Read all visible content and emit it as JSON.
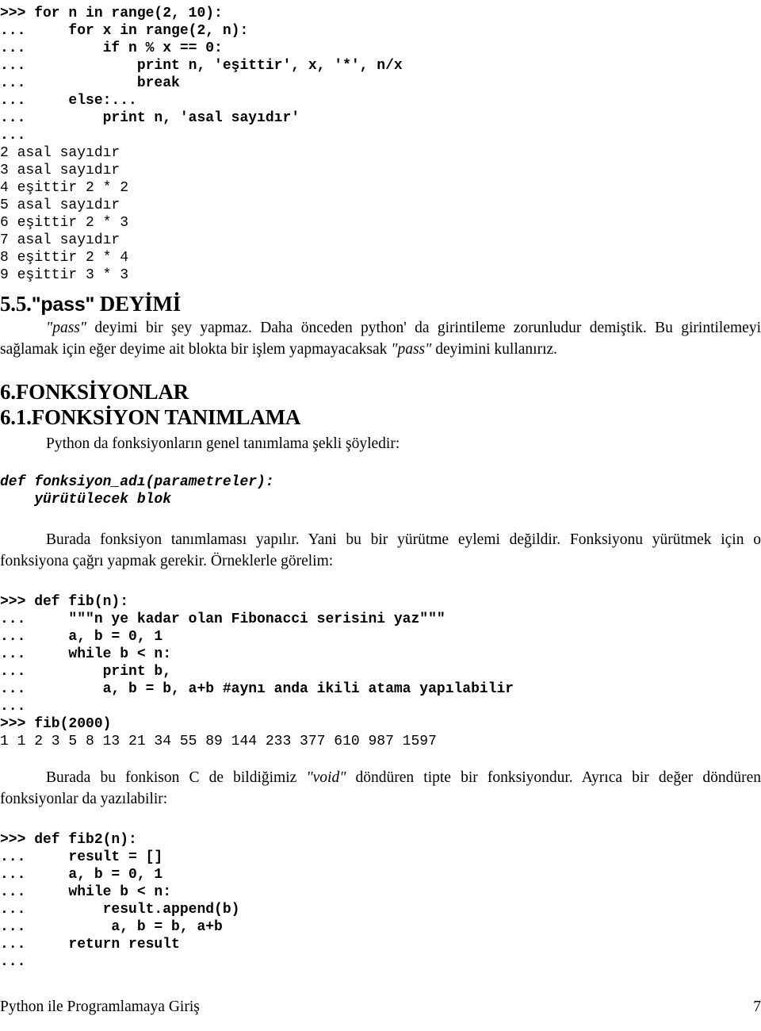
{
  "document": {
    "footer": {
      "title": "Python ile Programlamaya Giriş",
      "page_number": "7"
    }
  },
  "console_block_primes": {
    "name": "prime-loop-console",
    "lines": [
      {
        "text": ">>> for n in range(2, 10):",
        "style": "bold"
      },
      {
        "text": "...     for x in range(2, n):",
        "style": "bold"
      },
      {
        "text": "...         if n % x == 0:",
        "style": "bold"
      },
      {
        "text": "...             print n, 'eşittir', x, '*', n/x",
        "style": "bold"
      },
      {
        "text": "...             break",
        "style": "bold"
      },
      {
        "text": "...     else:...",
        "style": "bold"
      },
      {
        "text": "...         print n, 'asal sayıdır'",
        "style": "bold"
      },
      {
        "text": "...",
        "style": "bold"
      },
      {
        "text": "2 asal sayıdır",
        "style": "plain"
      },
      {
        "text": "3 asal sayıdır",
        "style": "plain"
      },
      {
        "text": "4 eşittir 2 * 2",
        "style": "plain"
      },
      {
        "text": "5 asal sayıdır",
        "style": "plain"
      },
      {
        "text": "6 eşittir 2 * 3",
        "style": "plain"
      },
      {
        "text": "7 asal sayıdır",
        "style": "plain"
      },
      {
        "text": "8 eşittir 2 * 4",
        "style": "plain"
      },
      {
        "text": "9 eşittir 3 * 3",
        "style": "plain"
      }
    ]
  },
  "section_pass": {
    "heading_number": "5.5.",
    "heading_quoted": "\"pass\"",
    "heading_rest": " DEYİMİ",
    "paragraph_part1": "\"pass\"",
    "paragraph_part2": " deyimi bir şey yapmaz. Daha önceden python' da girintileme zorunludur demiştik. Bu girintilemeyi sağlamak için eğer deyime ait blokta bir işlem yapmayacaksak ",
    "paragraph_part3": "\"pass\"",
    "paragraph_part4": " deyimini kullanırız."
  },
  "section_functions": {
    "heading_main": "6.FONKSİYONLAR",
    "heading_sub": "6.1.FONKSİYON TANIMLAMA",
    "intro": "Python da fonksiyonların genel tanımlama şekli şöyledir:"
  },
  "syntax_block": {
    "name": "function-definition-syntax",
    "lines": [
      {
        "text": "def fonksiyon_adı(parametreler):",
        "style": "bolditalic"
      },
      {
        "text": "    yürütülecek blok",
        "style": "bolditalic"
      }
    ]
  },
  "paragraph_call": {
    "text": "Burada fonksiyon tanımlaması yapılır. Yani bu bir yürütme eylemi değildir. Fonksiyonu yürütmek için o fonksiyona çağrı yapmak gerekir. Örneklerle görelim:"
  },
  "console_block_fib": {
    "name": "fib-console",
    "lines": [
      {
        "text": ">>> def fib(n):",
        "style": "bold"
      },
      {
        "text": "...     \"\"\"n ye kadar olan Fibonacci serisini yaz\"\"\"",
        "style": "bold"
      },
      {
        "text": "...     a, b = 0, 1",
        "style": "bold"
      },
      {
        "text": "...     while b < n:",
        "style": "bold"
      },
      {
        "text": "...         print b,",
        "style": "bold"
      },
      {
        "text": "...         a, b = b, a+b #aynı anda ikili atama yapılabilir",
        "style": "bold"
      },
      {
        "text": "...",
        "style": "bold"
      },
      {
        "text": ">>> fib(2000)",
        "style": "bold"
      },
      {
        "text": "1 1 2 3 5 8 13 21 34 55 89 144 233 377 610 987 1597",
        "style": "plain"
      }
    ]
  },
  "paragraph_void": {
    "part1": "Burada bu fonkison C de bildiğimiz ",
    "quoted": "\"void\"",
    "part2": " döndüren tipte bir fonksiyondur. Ayrıca bir değer döndüren fonksiyonlar da yazılabilir:"
  },
  "console_block_fib2": {
    "name": "fib2-console",
    "lines": [
      {
        "text": ">>> def fib2(n):",
        "style": "bold"
      },
      {
        "text": "...     result = []",
        "style": "bold"
      },
      {
        "text": "...     a, b = 0, 1",
        "style": "bold"
      },
      {
        "text": "...     while b < n:",
        "style": "bold"
      },
      {
        "text": "...         result.append(b)",
        "style": "bold"
      },
      {
        "text": "...          a, b = b, a+b",
        "style": "bold"
      },
      {
        "text": "...     return result",
        "style": "bold"
      },
      {
        "text": "...",
        "style": "bold"
      }
    ]
  }
}
